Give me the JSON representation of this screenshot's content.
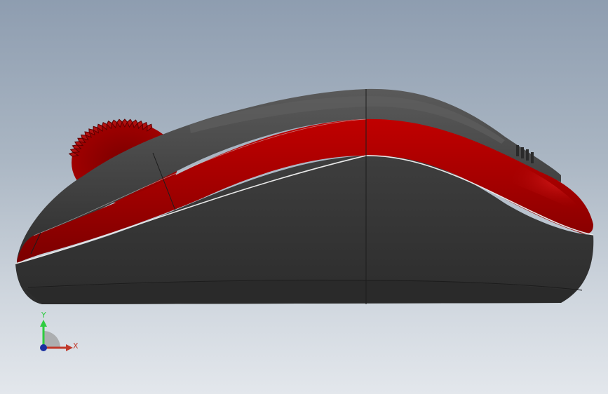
{
  "viewport": {
    "background_top": "#8e9db0",
    "background_bottom": "#e3e7ec"
  },
  "model": {
    "name": "wireless mouse",
    "body_color": "#3a3a3a",
    "accent_color": "#a30000",
    "wheel_color": "#8c0000"
  },
  "triad": {
    "x_label": "X",
    "y_label": "Y",
    "x_color": "#c0392b",
    "y_color": "#2ecc40",
    "z_color": "#1a2fa0"
  }
}
